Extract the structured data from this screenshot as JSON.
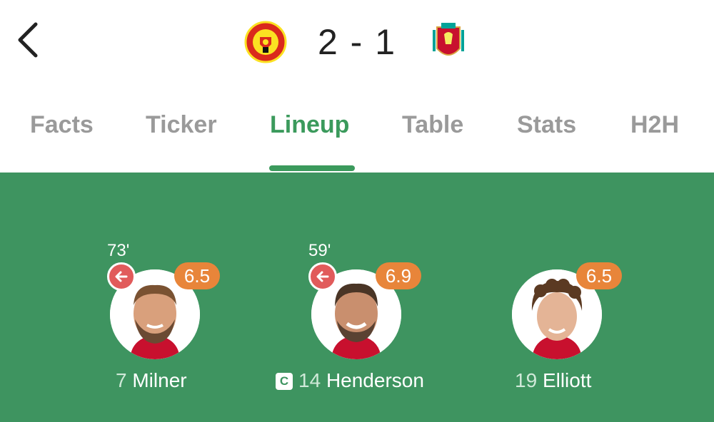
{
  "header": {
    "back_icon": "chevron-left-icon",
    "home_crest": "manchester-united-crest",
    "away_crest": "liverpool-crest",
    "score": "2 - 1"
  },
  "tabs": [
    {
      "label": "Facts"
    },
    {
      "label": "Ticker"
    },
    {
      "label": "Lineup",
      "active": true
    },
    {
      "label": "Table"
    },
    {
      "label": "Stats"
    },
    {
      "label": "H2H"
    }
  ],
  "colors": {
    "accent": "#3b9a5c",
    "pitch": "#3e9460",
    "rating": "#e8853a",
    "sub_out": "#e15b5b",
    "inactive_tab": "#9a9a9a"
  },
  "players": [
    {
      "sub_time": "73'",
      "rating": "6.5",
      "number": "7",
      "name": "Milner",
      "subbed_off": true,
      "captain": false
    },
    {
      "sub_time": "59'",
      "rating": "6.9",
      "number": "14",
      "name": "Henderson",
      "subbed_off": true,
      "captain": true,
      "captain_badge": "C"
    },
    {
      "sub_time": "",
      "rating": "6.5",
      "number": "19",
      "name": "Elliott",
      "subbed_off": false,
      "captain": false
    }
  ]
}
